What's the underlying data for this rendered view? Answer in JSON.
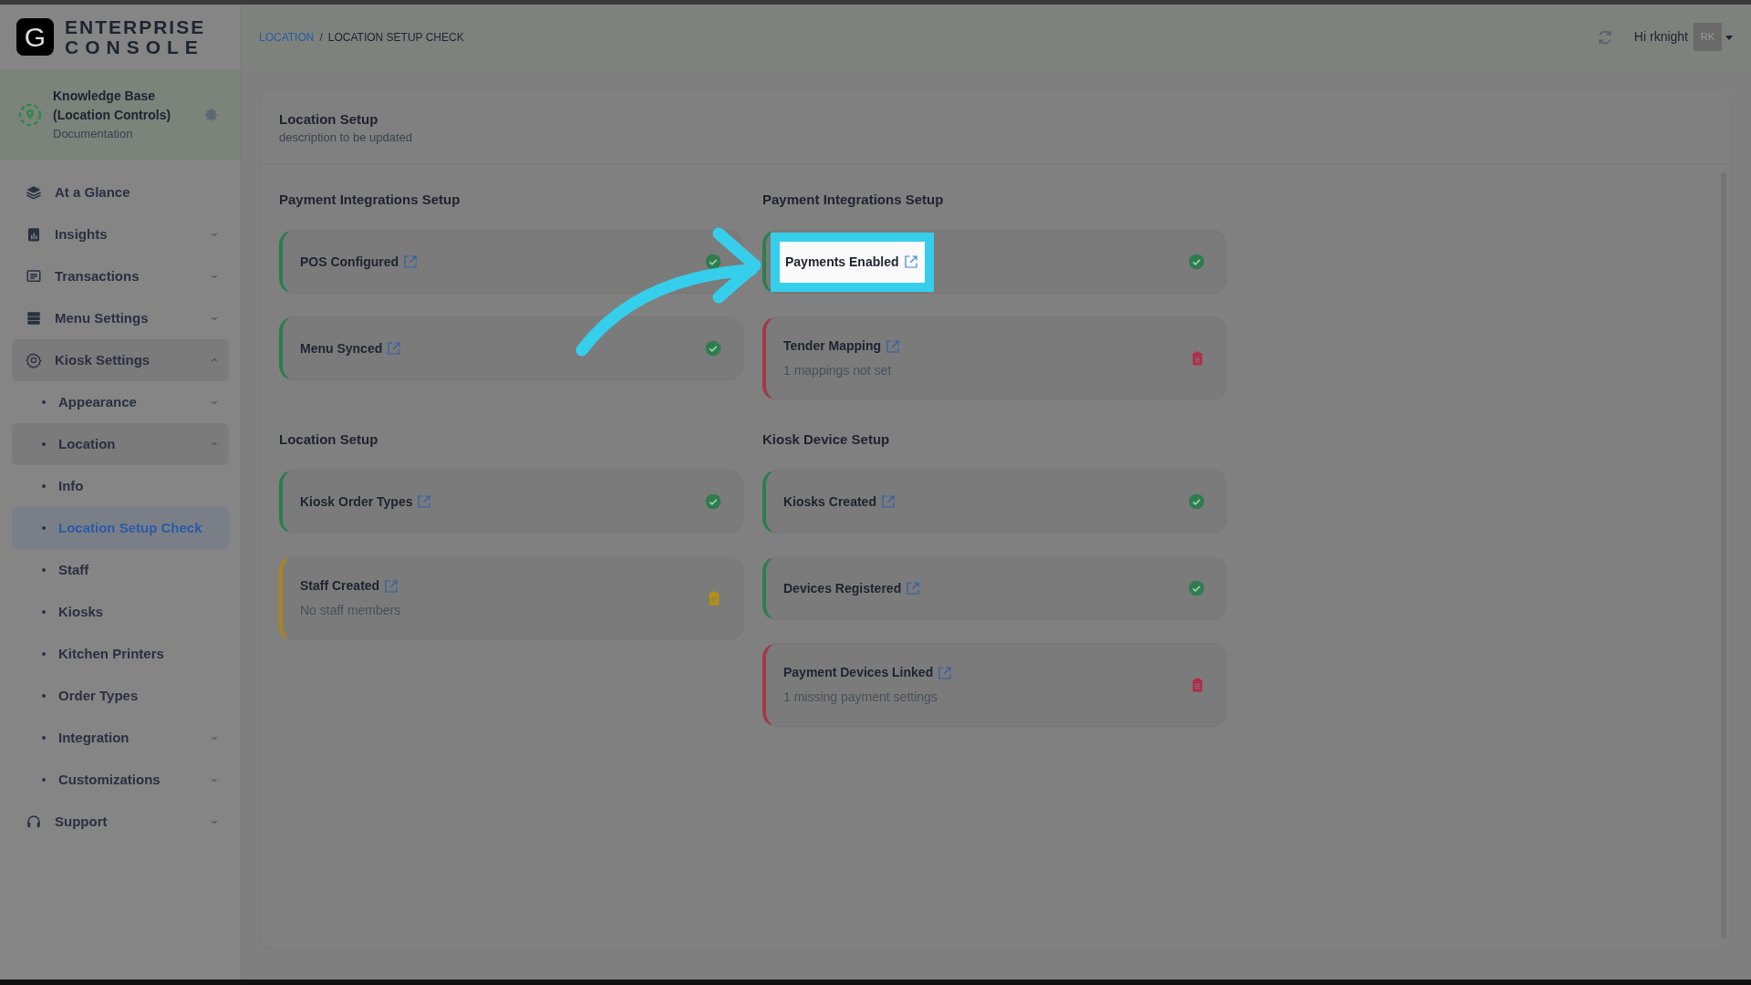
{
  "brand": {
    "logo_letter": "G",
    "lines": [
      "ENTERPRISE",
      "CONSOLE"
    ]
  },
  "workspace": {
    "name": "Knowledge Base (Location Controls)",
    "subtitle": "Documentation"
  },
  "nav": [
    {
      "label": "At a Glance",
      "selected": false
    },
    {
      "label": "Insights",
      "selected": false,
      "expanded": false
    },
    {
      "label": "Transactions",
      "selected": false,
      "expanded": false
    },
    {
      "label": "Menu Settings",
      "selected": false,
      "expanded": false
    },
    {
      "label": "Kiosk Settings",
      "selected": false,
      "expanded": true,
      "children": [
        {
          "label": "Appearance",
          "selected": false,
          "expanded": false
        },
        {
          "label": "Location",
          "selected": false,
          "expanded": true,
          "children": [
            {
              "label": "Info",
              "selected": false
            },
            {
              "label": "Location Setup Check",
              "selected": true
            }
          ]
        },
        {
          "label": "Staff",
          "selected": false
        },
        {
          "label": "Kiosks",
          "selected": false
        },
        {
          "label": "Kitchen Printers",
          "selected": false
        },
        {
          "label": "Order Types",
          "selected": false
        },
        {
          "label": "Integration",
          "selected": false,
          "expanded": false
        },
        {
          "label": "Customizations",
          "selected": false,
          "expanded": false
        }
      ]
    },
    {
      "label": "Support",
      "selected": false,
      "expanded": false
    }
  ],
  "breadcrumb": {
    "separator": "/",
    "items": [
      {
        "label": "LOCATION",
        "link": true
      },
      {
        "label": "LOCATION SETUP CHECK",
        "link": false
      }
    ]
  },
  "user": {
    "greeting": "Hi rknight",
    "avatar": "RK"
  },
  "panel": {
    "title": "Location Setup",
    "description": "description to be updated",
    "columns": [
      [
        {
          "heading": "Payment Integrations Setup",
          "items": [
            {
              "title": "POS Configured",
              "kind": "ok",
              "highlighted": false
            },
            {
              "title": "Menu Synced",
              "kind": "ok",
              "highlighted": false
            }
          ]
        },
        {
          "heading": "Location Setup",
          "items": [
            {
              "title": "Kiosk Order Types",
              "kind": "ok",
              "highlighted": false
            },
            {
              "title": "Staff Created",
              "detail": "No staff members",
              "kind": "warning",
              "highlighted": false
            }
          ]
        }
      ],
      [
        {
          "heading": "Payment Integrations Setup",
          "items": [
            {
              "title": "Payments Enabled",
              "kind": "ok",
              "highlighted": true
            },
            {
              "title": "Tender Mapping",
              "detail": "1 mappings not set",
              "kind": "error",
              "highlighted": false
            }
          ]
        },
        {
          "heading": "Kiosk Device Setup",
          "items": [
            {
              "title": "Kiosks Created",
              "kind": "ok",
              "highlighted": false
            },
            {
              "title": "Devices Registered",
              "kind": "ok",
              "highlighted": false
            },
            {
              "title": "Payment Devices Linked",
              "detail": "1 missing payment settings",
              "kind": "error",
              "highlighted": false
            }
          ]
        }
      ]
    ]
  }
}
